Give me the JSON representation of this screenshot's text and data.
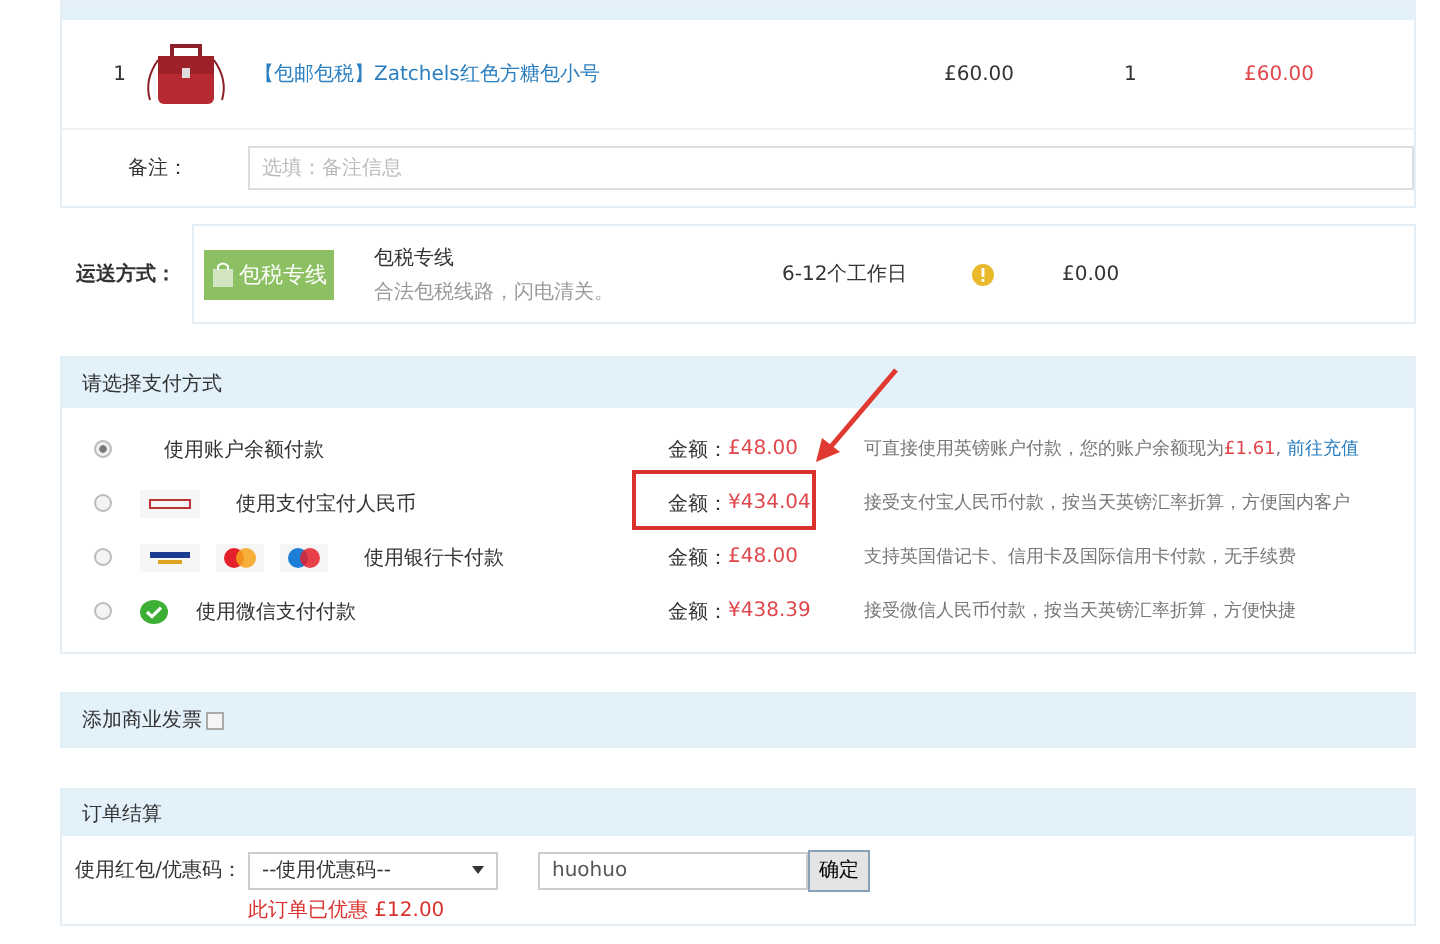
{
  "order_table": {
    "rows": [
      {
        "index": "1",
        "name": "【包邮包税】Zatchels红色方糖包小号",
        "price": "£60.00",
        "quantity": "1",
        "subtotal": "£60.00"
      }
    ],
    "note": {
      "label": "备注：",
      "placeholder": "选填：备注信息"
    }
  },
  "shipping": {
    "label": "运送方式：",
    "badge": "包税专线",
    "name": "包税专线",
    "description": "合法包税线路，闪电清关。",
    "time": "6-12个工作日",
    "fee": "£0.00"
  },
  "payment": {
    "title": "请选择支付方式",
    "methods": [
      {
        "kind": "balance",
        "label": "使用账户余额付款",
        "selected": true,
        "highlighted": false,
        "amount_label": "金额：",
        "amount": "£48.00",
        "description": "可直接使用英镑账户付款，您的账户余额现为",
        "balance": "£1.61",
        "balance_suffix": ",",
        "link": "前往充值"
      },
      {
        "kind": "alipay",
        "label": "使用支付宝付人民币",
        "selected": false,
        "highlighted": true,
        "amount_label": "金额：",
        "amount": "¥434.04",
        "description": "接受支付宝人民币付款，按当天英镑汇率折算，方便国内客户"
      },
      {
        "kind": "card",
        "label": "使用银行卡付款",
        "selected": false,
        "highlighted": false,
        "amount_label": "金额：",
        "amount": "£48.00",
        "description": "支持英国借记卡、信用卡及国际信用卡付款，无手续费"
      },
      {
        "kind": "wechat",
        "label": "使用微信支付付款",
        "selected": false,
        "highlighted": false,
        "amount_label": "金额：",
        "amount": "¥438.39",
        "description": "接受微信人民币付款，按当天英镑汇率折算，方便快捷"
      }
    ]
  },
  "invoice": {
    "label": "添加商业发票",
    "checked": false
  },
  "settlement": {
    "title": "订单结算",
    "coupon_label": "使用红包/优惠码：",
    "coupon_select": "--使用优惠码--",
    "code_value": "huohuo",
    "confirm": "确定",
    "discount_note": "此订单已优惠 £12.00"
  }
}
